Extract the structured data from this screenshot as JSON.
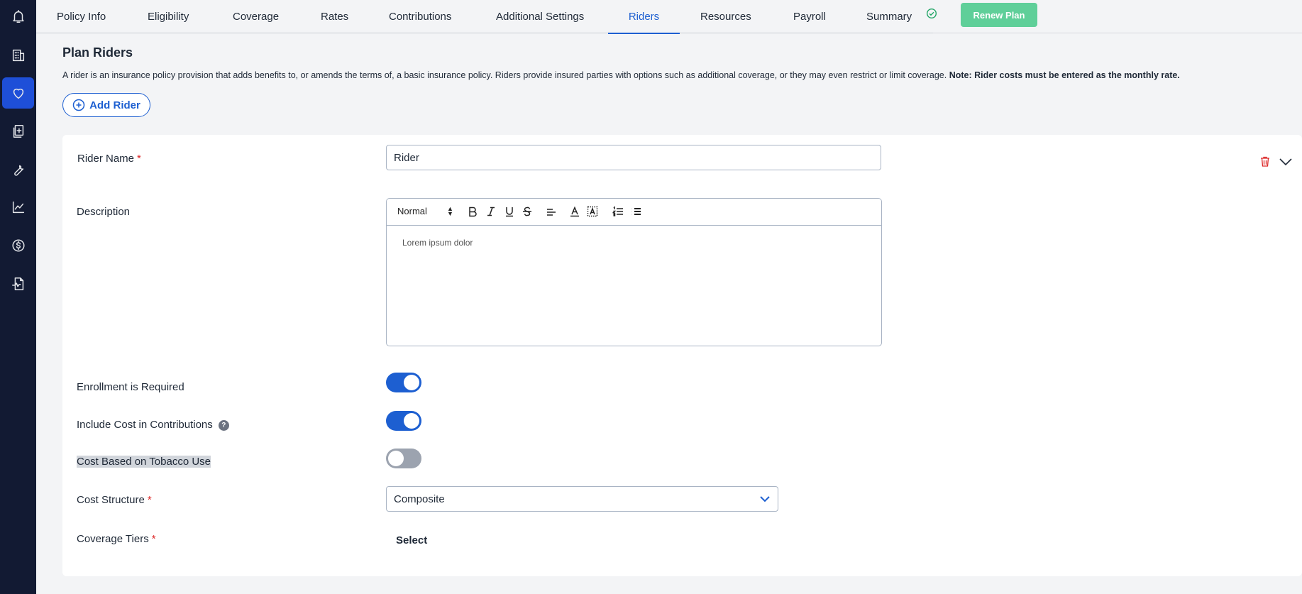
{
  "sidebar": {
    "items": [
      {
        "icon": "bell-icon"
      },
      {
        "icon": "building-icon"
      },
      {
        "icon": "heart-icon",
        "active": true
      },
      {
        "icon": "document-add-icon"
      },
      {
        "icon": "wrench-icon"
      },
      {
        "icon": "chart-icon"
      },
      {
        "icon": "dollar-icon"
      },
      {
        "icon": "report-icon"
      }
    ]
  },
  "tabs": [
    {
      "label": "Policy Info"
    },
    {
      "label": "Eligibility"
    },
    {
      "label": "Coverage"
    },
    {
      "label": "Rates"
    },
    {
      "label": "Contributions"
    },
    {
      "label": "Additional Settings"
    },
    {
      "label": "Riders",
      "active": true
    },
    {
      "label": "Resources"
    },
    {
      "label": "Payroll"
    },
    {
      "label": "Summary"
    }
  ],
  "header": {
    "renew_label": "Renew Plan",
    "title": "Plan Riders",
    "description": "A rider is an insurance policy provision that adds benefits to, or amends the terms of, a basic insurance policy. Riders provide insured parties with options such as additional coverage, or they may even restrict or limit coverage.",
    "note": "Note: Rider costs must be entered as the monthly rate.",
    "add_rider_label": "Add Rider"
  },
  "form": {
    "rider_name_label": "Rider Name",
    "rider_name_value": "Rider",
    "required_mark": "*",
    "description_label": "Description",
    "editor_heading": "Normal",
    "editor_content": "Lorem ipsum dolor",
    "enrollment_label": "Enrollment is Required",
    "enrollment_on": true,
    "include_cost_label": "Include Cost in Contributions",
    "include_cost_on": true,
    "help_glyph": "?",
    "tobacco_label": "Cost Based on Tobacco Use",
    "tobacco_on": false,
    "cost_structure_label": "Cost Structure",
    "cost_structure_value": "Composite",
    "coverage_tiers_label": "Coverage Tiers",
    "coverage_tiers_action": "Select"
  },
  "colors": {
    "sidebar_bg": "#121a33",
    "accent": "#1d5fd1",
    "renew_button": "#5fcf99",
    "required": "#dc2626"
  }
}
